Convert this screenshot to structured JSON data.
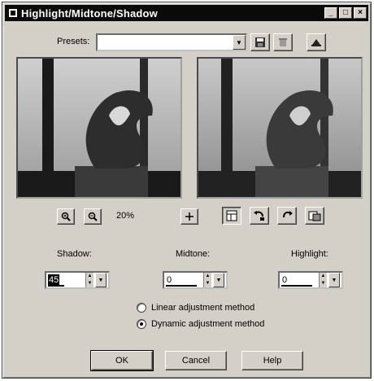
{
  "window": {
    "title": "Highlight/Midtone/Shadow",
    "controls": {
      "minimize": "_",
      "maximize": "□",
      "close": "×"
    }
  },
  "presets": {
    "label": "Presets:",
    "value": ""
  },
  "zoom": {
    "value": "20%"
  },
  "fields": {
    "shadow": {
      "label": "Shadow:",
      "value": "45"
    },
    "midtone": {
      "label": "Midtone:",
      "value": "0"
    },
    "highlight": {
      "label": "Highlight:",
      "value": "0"
    }
  },
  "method": {
    "options": [
      {
        "label": "Linear adjustment method",
        "selected": false
      },
      {
        "label": "Dynamic adjustment method",
        "selected": true
      }
    ]
  },
  "buttons": {
    "ok": "OK",
    "cancel": "Cancel",
    "help": "Help"
  },
  "icons": {
    "save_preset": "floppy-disk-icon",
    "delete_preset": "delete-icon",
    "reset_preset": "reset-icon",
    "zoom_in": "zoom-in-icon",
    "zoom_out": "zoom-out-icon",
    "pan": "move-cross-icon",
    "proof": "window-icon",
    "undo": "undo-icon",
    "redo": "redo-icon",
    "auto_proof": "auto-proof-icon"
  }
}
